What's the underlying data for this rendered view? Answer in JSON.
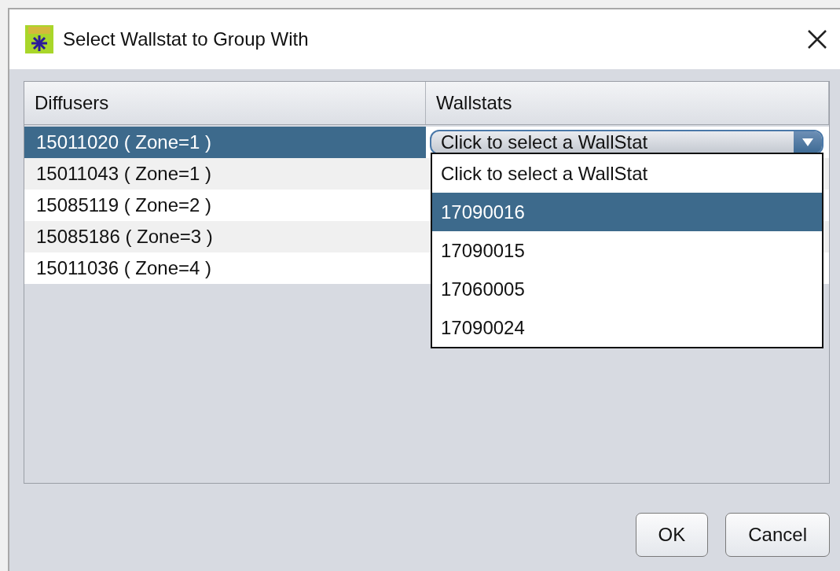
{
  "window": {
    "title": "Select Wallstat to Group With"
  },
  "table": {
    "columns": [
      "Diffusers",
      "Wallstats"
    ],
    "rows": [
      {
        "diffuser": "15011020 ( Zone=1 )",
        "selected": true
      },
      {
        "diffuser": "15011043 ( Zone=1 )",
        "selected": false
      },
      {
        "diffuser": "15085119 ( Zone=2 )",
        "selected": false
      },
      {
        "diffuser": "15085186 ( Zone=3 )",
        "selected": false
      },
      {
        "diffuser": "15011036 ( Zone=4 )",
        "selected": false
      }
    ]
  },
  "wallstat_combo": {
    "value": "Click to select a WallStat",
    "expanded": true,
    "options": [
      {
        "label": "Click to select a WallStat",
        "highlighted": false
      },
      {
        "label": "17090016",
        "highlighted": true
      },
      {
        "label": "17090015",
        "highlighted": false
      },
      {
        "label": "17060005",
        "highlighted": false
      },
      {
        "label": "17090024",
        "highlighted": false
      }
    ]
  },
  "buttons": [
    "OK",
    "Cancel"
  ]
}
